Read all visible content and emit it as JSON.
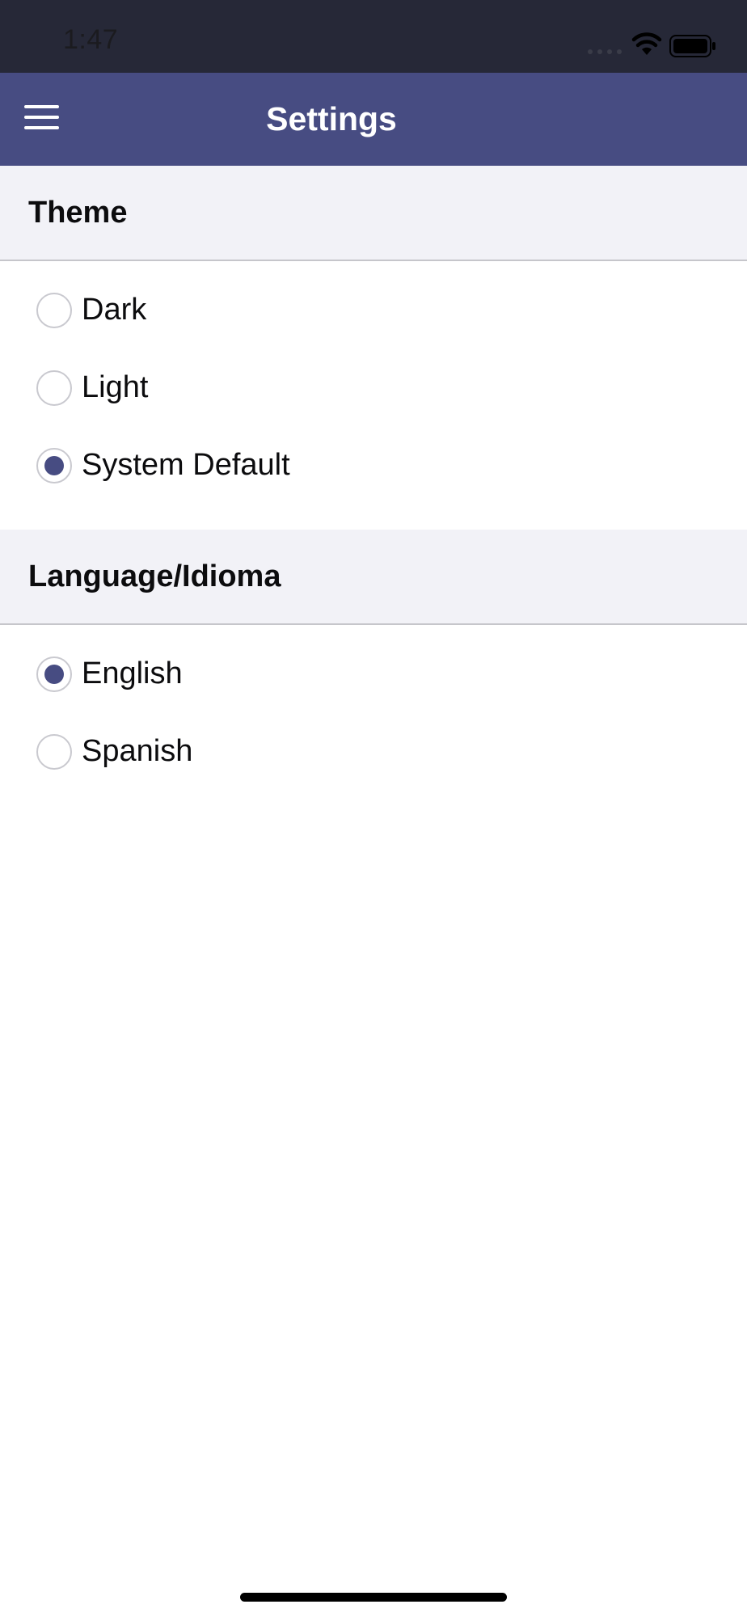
{
  "status_bar": {
    "time": "1:47",
    "icons": [
      "signal-icon",
      "wifi-icon",
      "battery-icon"
    ]
  },
  "nav": {
    "title": "Settings",
    "menu_icon": "hamburger-menu-icon"
  },
  "sections": {
    "theme": {
      "header": "Theme",
      "options": [
        {
          "label": "Dark",
          "selected": false
        },
        {
          "label": "Light",
          "selected": false
        },
        {
          "label": "System Default",
          "selected": true
        }
      ]
    },
    "language": {
      "header": "Language/Idioma",
      "options": [
        {
          "label": "English",
          "selected": true
        },
        {
          "label": "Spanish",
          "selected": false
        }
      ]
    }
  },
  "colors": {
    "status_bar_bg": "#262837",
    "nav_bg": "#474c82",
    "radio_selected": "#474c82",
    "section_header_bg": "#f2f2f7"
  }
}
